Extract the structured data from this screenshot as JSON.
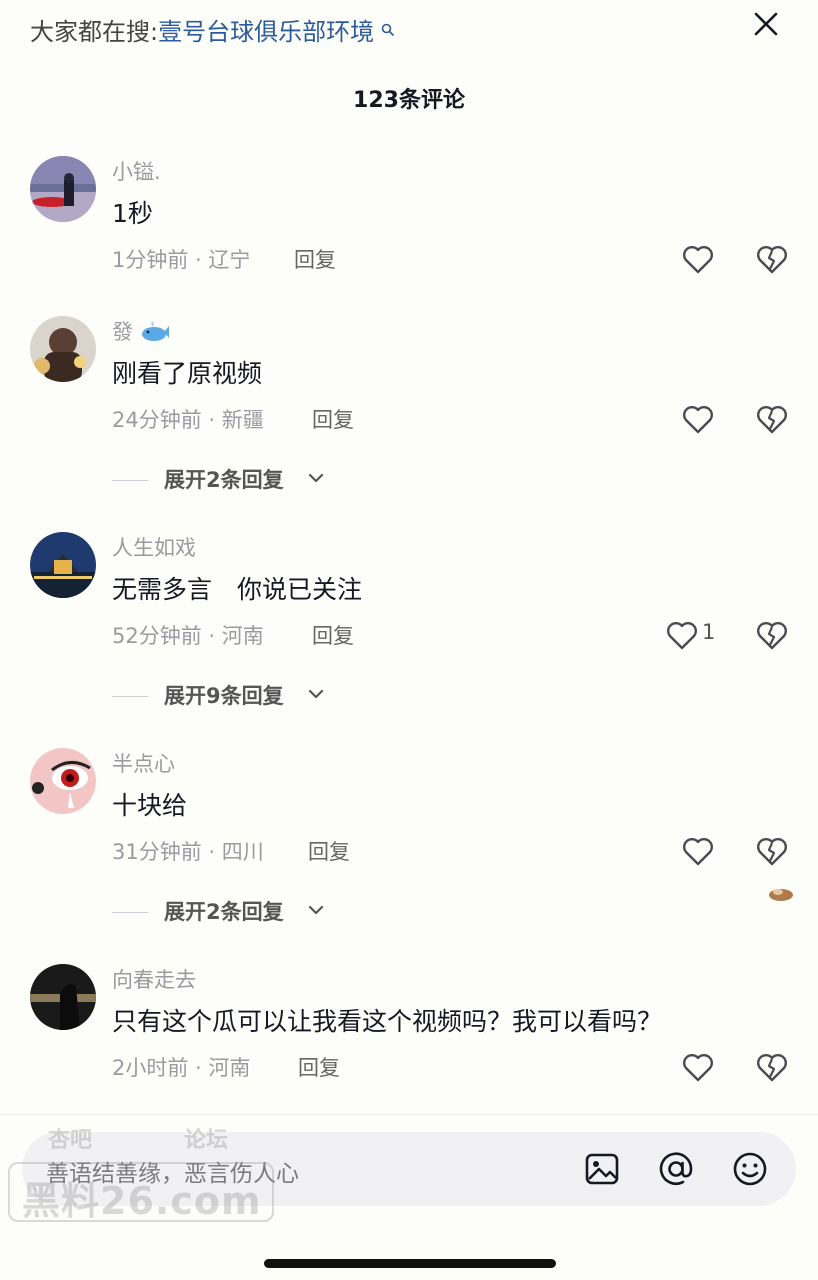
{
  "search": {
    "prefix": "大家都在搜:",
    "term": "壹号台球俱乐部环境"
  },
  "header": {
    "title": "123条评论"
  },
  "comments": [
    {
      "username": "小镒.",
      "text": "1秒",
      "time_location": "1分钟前 · 辽宁",
      "reply_label": "回复"
    },
    {
      "username": "發",
      "username_icon": "whale-icon",
      "text": "刚看了原视频",
      "time_location": "24分钟前 · 新疆",
      "reply_label": "回复",
      "expand_label": "展开2条回复"
    },
    {
      "username": "人生如戏",
      "text": "无需多言　你说已关注",
      "time_location": "52分钟前 · 河南",
      "reply_label": "回复",
      "likes": "1",
      "expand_label": "展开9条回复"
    },
    {
      "username": "半点心",
      "text": "十块给",
      "time_location": "31分钟前 · 四川",
      "reply_label": "回复",
      "expand_label": "展开2条回复"
    },
    {
      "username": "向春走去",
      "text": "只有这个瓜可以让我看这个视频吗？我可以看吗？",
      "time_location": "2小时前 · 河南",
      "reply_label": "回复"
    }
  ],
  "input": {
    "placeholder": "善语结善缘，恶言伤人心"
  },
  "watermark": {
    "top_left": "杏吧",
    "top_right": "论坛",
    "main": "黑料26.com"
  },
  "colors": {
    "background": "#fdfdf9",
    "link_blue": "#2b5b9b",
    "meta_gray": "#9a9aa1",
    "text_dark": "#161823"
  }
}
